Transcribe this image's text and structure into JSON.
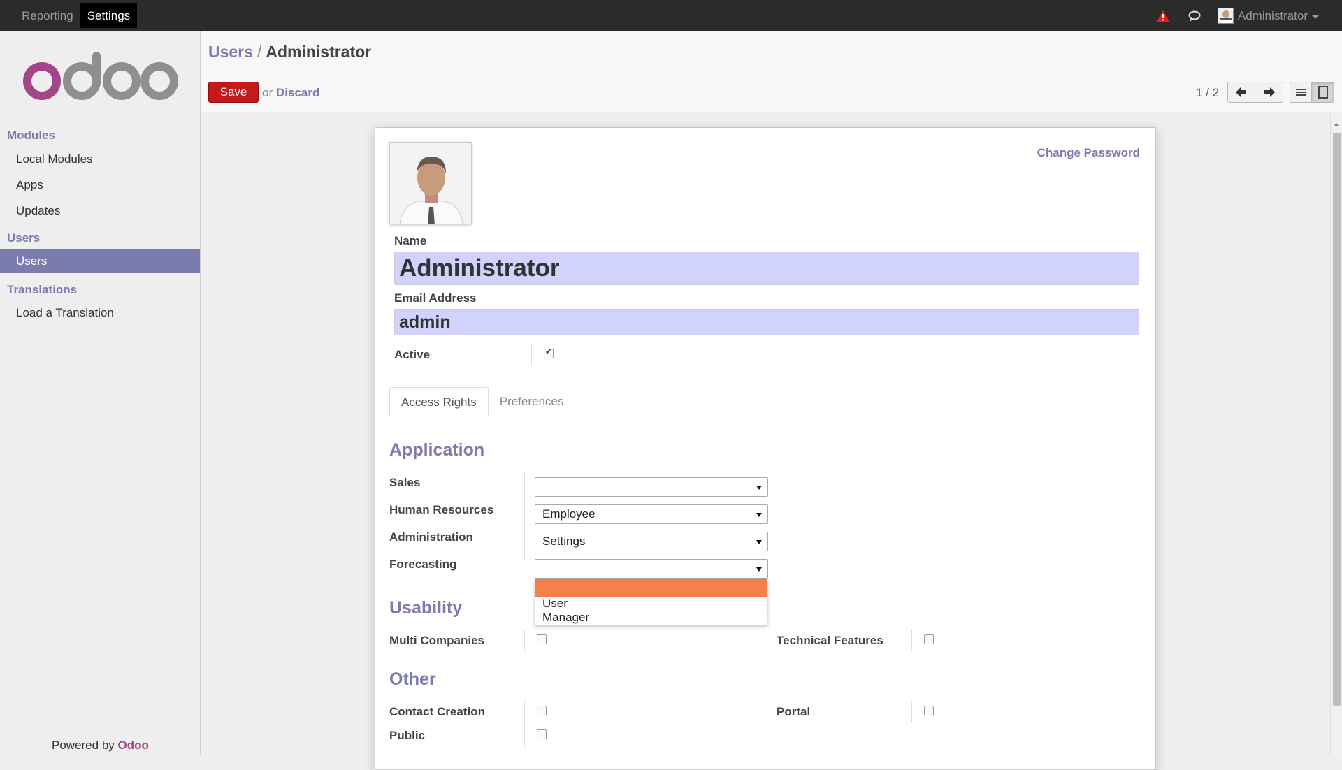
{
  "topbar": {
    "menu": [
      "Reporting",
      "Settings"
    ],
    "user": "Administrator"
  },
  "sidebar": {
    "sections": [
      {
        "title": "Modules",
        "items": [
          "Local Modules",
          "Apps",
          "Updates"
        ]
      },
      {
        "title": "Users",
        "items": [
          "Users"
        ]
      },
      {
        "title": "Translations",
        "items": [
          "Load a Translation"
        ]
      }
    ],
    "powered_prefix": "Powered by",
    "powered_brand": "Odoo"
  },
  "control_panel": {
    "breadcrumb_parent": "Users",
    "breadcrumb_sep": "/",
    "breadcrumb_current": "Administrator",
    "save_label": "Save",
    "or_label": "or",
    "discard_label": "Discard",
    "pager": "1 / 2"
  },
  "form": {
    "change_password": "Change Password",
    "name_label": "Name",
    "name_value": "Administrator",
    "email_label": "Email Address",
    "email_value": "admin",
    "active_label": "Active",
    "active_checked": true,
    "tabs": [
      "Access Rights",
      "Preferences"
    ],
    "application_title": "Application",
    "fields": [
      {
        "label": "Sales",
        "value": ""
      },
      {
        "label": "Human Resources",
        "value": "Employee"
      },
      {
        "label": "Administration",
        "value": "Settings"
      },
      {
        "label": "Forecasting",
        "value": ""
      }
    ],
    "dropdown_options": [
      "",
      "User",
      "Manager"
    ],
    "usability_title": "Usability",
    "multi_companies_label": "Multi Companies",
    "technical_features_label": "Technical Features",
    "other_title": "Other",
    "contact_creation_label": "Contact Creation",
    "portal_label": "Portal",
    "public_label": "Public"
  },
  "colors": {
    "accent": "#7c7bad",
    "save": "#c6191a",
    "highlight": "#f4804c",
    "input_bg": "#d2d2ff"
  }
}
